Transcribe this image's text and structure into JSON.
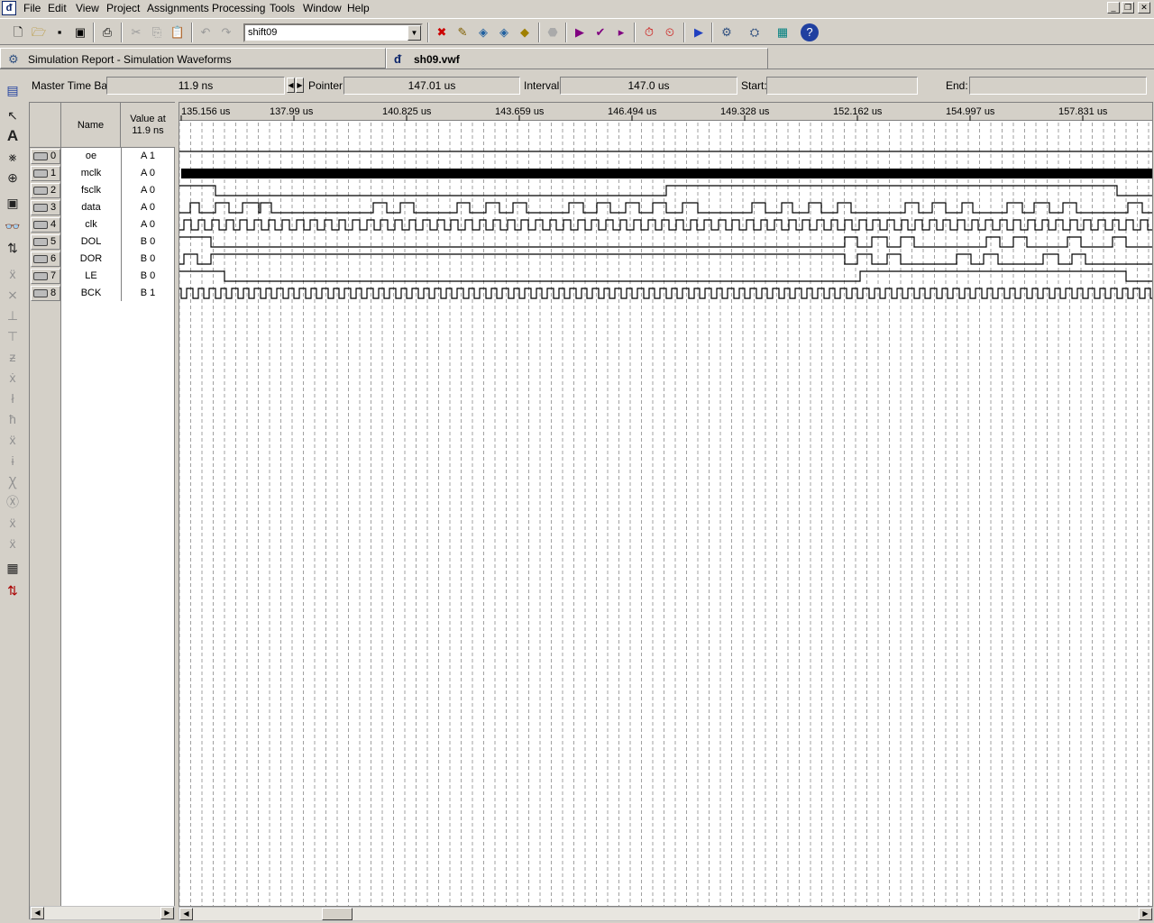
{
  "menu": [
    "File",
    "Edit",
    "View",
    "Project",
    "Assignments",
    "Processing",
    "Tools",
    "Window",
    "Help"
  ],
  "app_logo": "ᵭ",
  "project_name": "shift09",
  "tabs": [
    {
      "label": "Simulation Report - Simulation Waveforms",
      "icon": "report-icon"
    },
    {
      "label": "sh09.vwf",
      "icon": "waveform-file-icon"
    }
  ],
  "timebar": {
    "master_label": "Master Time Bar:",
    "master_value": "11.9 ns",
    "pointer_label": "Pointer:",
    "pointer_value": "147.01 us",
    "interval_label": "Interval:",
    "interval_value": "147.0 us",
    "start_label": "Start:",
    "start_value": "",
    "end_label": "End:",
    "end_value": ""
  },
  "table_header": {
    "name": "Name",
    "value_line1": "Value at",
    "value_line2": "11.9 ns"
  },
  "signals": [
    {
      "idx": "0",
      "name": "oe",
      "value": "A 1",
      "dir": "input"
    },
    {
      "idx": "1",
      "name": "mclk",
      "value": "A 0",
      "dir": "input"
    },
    {
      "idx": "2",
      "name": "fsclk",
      "value": "A 0",
      "dir": "input"
    },
    {
      "idx": "3",
      "name": "data",
      "value": "A 0",
      "dir": "input"
    },
    {
      "idx": "4",
      "name": "clk",
      "value": "A 0",
      "dir": "input"
    },
    {
      "idx": "5",
      "name": "DOL",
      "value": "B 0",
      "dir": "output"
    },
    {
      "idx": "6",
      "name": "DOR",
      "value": "B 0",
      "dir": "output"
    },
    {
      "idx": "7",
      "name": "LE",
      "value": "B 0",
      "dir": "output"
    },
    {
      "idx": "8",
      "name": "BCK",
      "value": "B 1",
      "dir": "output"
    }
  ],
  "time_ticks": [
    "135.156 us",
    "137.99 us",
    "140.825 us",
    "143.659 us",
    "146.494 us",
    "149.328 us",
    "152.162 us",
    "154.997 us",
    "157.831 us"
  ],
  "toolbar_icons": [
    "new-file-icon",
    "open-icon",
    "save-icon",
    "save-all-icon",
    "print-icon",
    "cut-icon",
    "copy-icon",
    "paste-icon",
    "undo-icon",
    "redo-icon",
    "project-combo",
    "chip-icon",
    "pencil-icon",
    "compile-icon",
    "analysis-icon",
    "fitter-icon",
    "stop-icon",
    "run-icon",
    "check-icon",
    "timing-icon",
    "timing-analyzer-icon",
    "clock-icon",
    "simulate-icon",
    "programmer-icon",
    "chip-planner-icon",
    "rtl-viewer-icon",
    "help-icon"
  ]
}
